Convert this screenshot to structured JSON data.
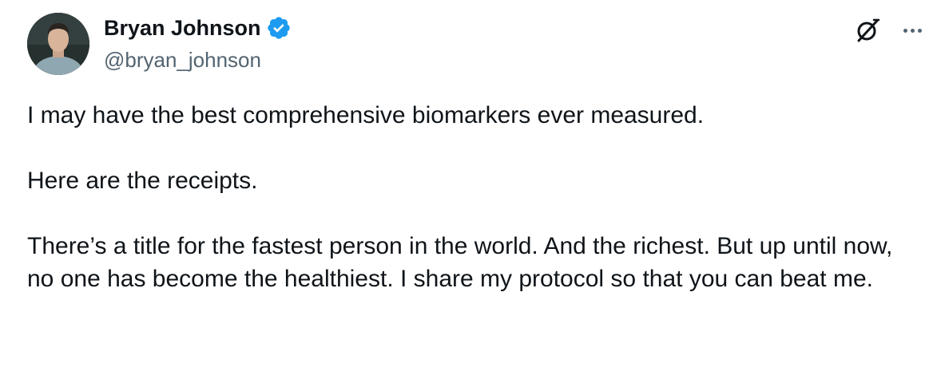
{
  "author": {
    "name": "Bryan Johnson",
    "handle": "@bryan_johnson",
    "verified": true
  },
  "icons": {
    "verified": "verified-badge-icon",
    "grok": "grok-icon",
    "more": "more-options-icon"
  },
  "colors": {
    "verified_blue": "#1d9bf0",
    "text_primary": "#0f1419",
    "text_secondary": "#536471"
  },
  "tweet": {
    "paragraphs": [
      "I may have the best comprehensive biomarkers ever measured.",
      "Here are the receipts.",
      "There’s a title for the fastest person in the world. And the richest. But up until now, no one has become the healthiest. I share my protocol so that you can beat me."
    ]
  }
}
